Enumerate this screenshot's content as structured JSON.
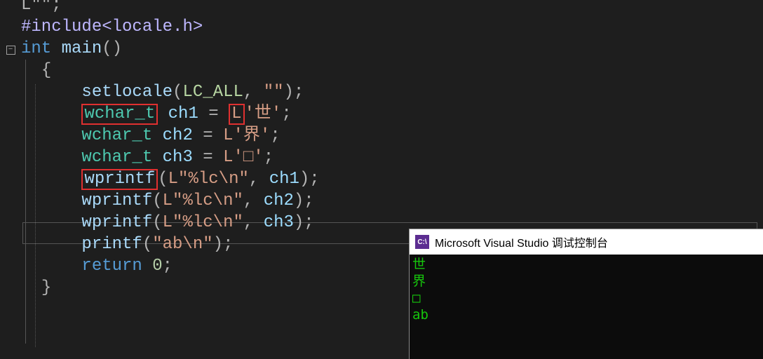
{
  "editor": {
    "lines": {
      "comment_open": "/**/",
      "include": "#include<locale.h>",
      "int": "int",
      "main": "main",
      "parens": "()",
      "brace_open": "{",
      "setlocale": "setlocale",
      "lc_all": "LC_ALL",
      "empty_str": "\"\"",
      "wchar_t": "wchar_t",
      "ch1": "ch1",
      "ch2": "ch2",
      "ch3": "ch3",
      "eq": " = ",
      "L": "L",
      "lit_shi": "'世'",
      "lit_jie": "'界'",
      "lit_sq": "'□'",
      "semi": ";",
      "wprintf": "wprintf",
      "printf": "printf",
      "fmt_lc": "L\"%lc\\n\"",
      "fmt_ab": "\"ab\\n\"",
      "comma": ", ",
      "return": "return",
      "zero": "0",
      "brace_close": "}"
    }
  },
  "console": {
    "title": "Microsoft Visual Studio 调试控制台",
    "icon_text": "C:\\",
    "output": {
      "l1": "世",
      "l2": "界",
      "l3": "□",
      "l4": "ab"
    }
  }
}
